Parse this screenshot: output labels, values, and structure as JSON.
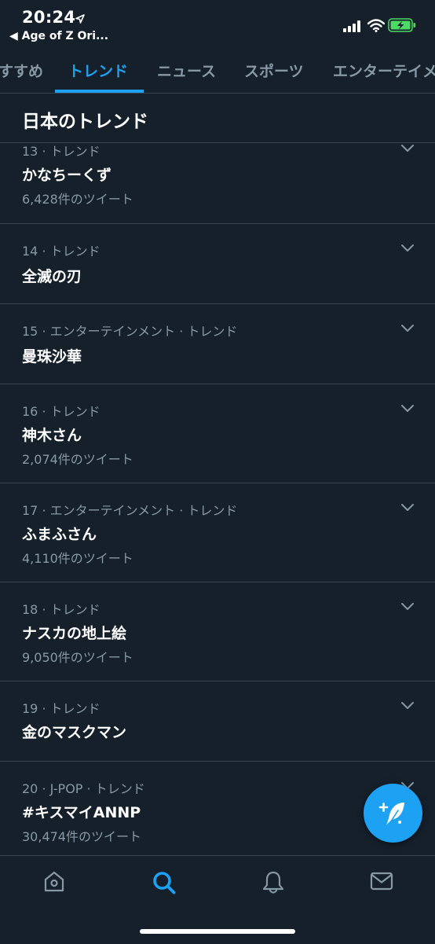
{
  "status": {
    "time": "20:24",
    "back_app": "◀ Age of Z Ori..."
  },
  "tabs": [
    {
      "label": "すすめ",
      "active": false
    },
    {
      "label": "トレンド",
      "active": true
    },
    {
      "label": "ニュース",
      "active": false
    },
    {
      "label": "スポーツ",
      "active": false
    },
    {
      "label": "エンターテイメ",
      "active": false
    }
  ],
  "section_title": "日本のトレンド",
  "trends": [
    {
      "meta": "13 · トレンド",
      "name": "かなちーくず",
      "count": "6,428件のツイート"
    },
    {
      "meta": "14 · トレンド",
      "name": "全滅の刃",
      "count": ""
    },
    {
      "meta": "15 · エンターテインメント · トレンド",
      "name": "曼珠沙華",
      "count": ""
    },
    {
      "meta": "16 · トレンド",
      "name": "神木さん",
      "count": "2,074件のツイート"
    },
    {
      "meta": "17 · エンターテインメント · トレンド",
      "name": "ふまふさん",
      "count": "4,110件のツイート"
    },
    {
      "meta": "18 · トレンド",
      "name": "ナスカの地上絵",
      "count": "9,050件のツイート"
    },
    {
      "meta": "19 · トレンド",
      "name": "金のマスクマン",
      "count": ""
    },
    {
      "meta": "20 · J-POP · トレンド",
      "name": "#キスマイANNP",
      "count": "30,474件のツイート"
    }
  ],
  "colors": {
    "background": "#15202b",
    "accent": "#1da1f2",
    "secondary_text": "#8899a6",
    "divider": "#38444d",
    "battery": "#4cd964"
  },
  "icons": {
    "fab": "compose-tweet-icon",
    "nav": [
      "home-icon",
      "search-icon",
      "notifications-bell-icon",
      "messages-envelope-icon"
    ],
    "active_nav": "search-icon"
  }
}
